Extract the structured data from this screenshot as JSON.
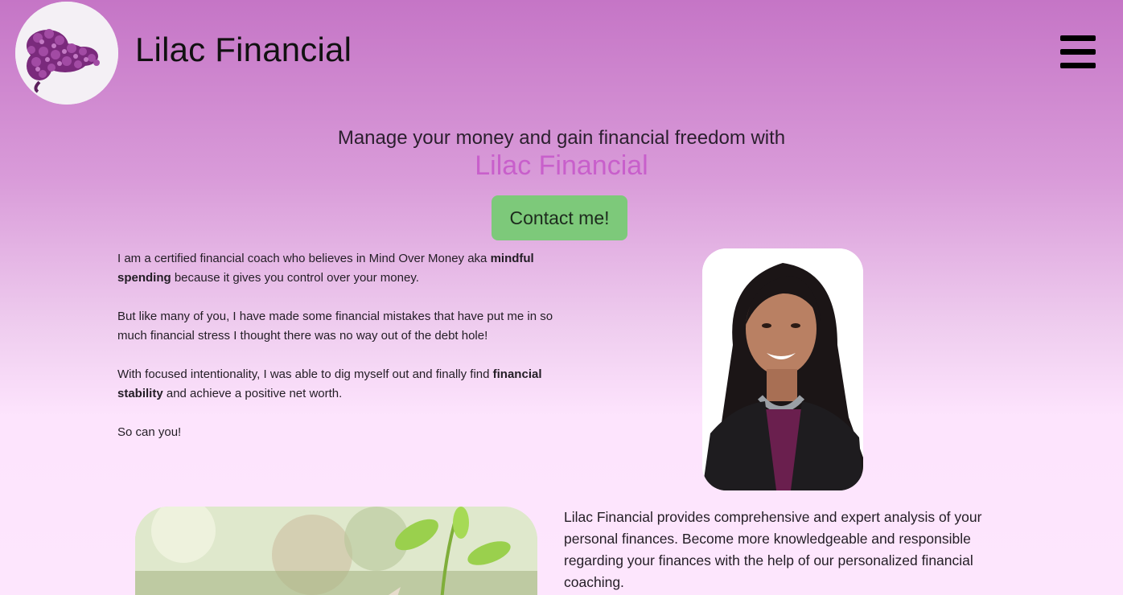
{
  "header": {
    "brand": "Lilac Financial",
    "logo_icon": "lilac-flower-icon",
    "menu_icon": "hamburger-menu-icon"
  },
  "hero": {
    "tagline": "Manage your money and gain financial freedom with",
    "tagline_brand": "Lilac Financial",
    "cta_label": "Contact me!"
  },
  "intro": {
    "p1_a": "I am a certified financial coach who believes in Mind Over Money aka ",
    "p1_bold": "mindful spending",
    "p1_b": " because it gives you control over your money.",
    "p2": "But like many of you, I have made some financial mistakes that have put me in so much financial stress I thought there was no way out of the debt hole!",
    "p3_a": "With focused intentionality, I was able to dig myself out and finally find ",
    "p3_bold": "financial stability",
    "p3_b": " and achieve a positive net worth.",
    "p4": "So can you!"
  },
  "services": {
    "text": "Lilac Financial provides comprehensive and expert analysis of your personal finances. Become more knowledgeable and responsible regarding your finances with the help of our personalized financial coaching."
  },
  "colors": {
    "accent": "#c85fcb",
    "cta_bg": "#7dc97a",
    "bg_top": "#c575c6",
    "bg_bottom": "#fde6fd"
  }
}
